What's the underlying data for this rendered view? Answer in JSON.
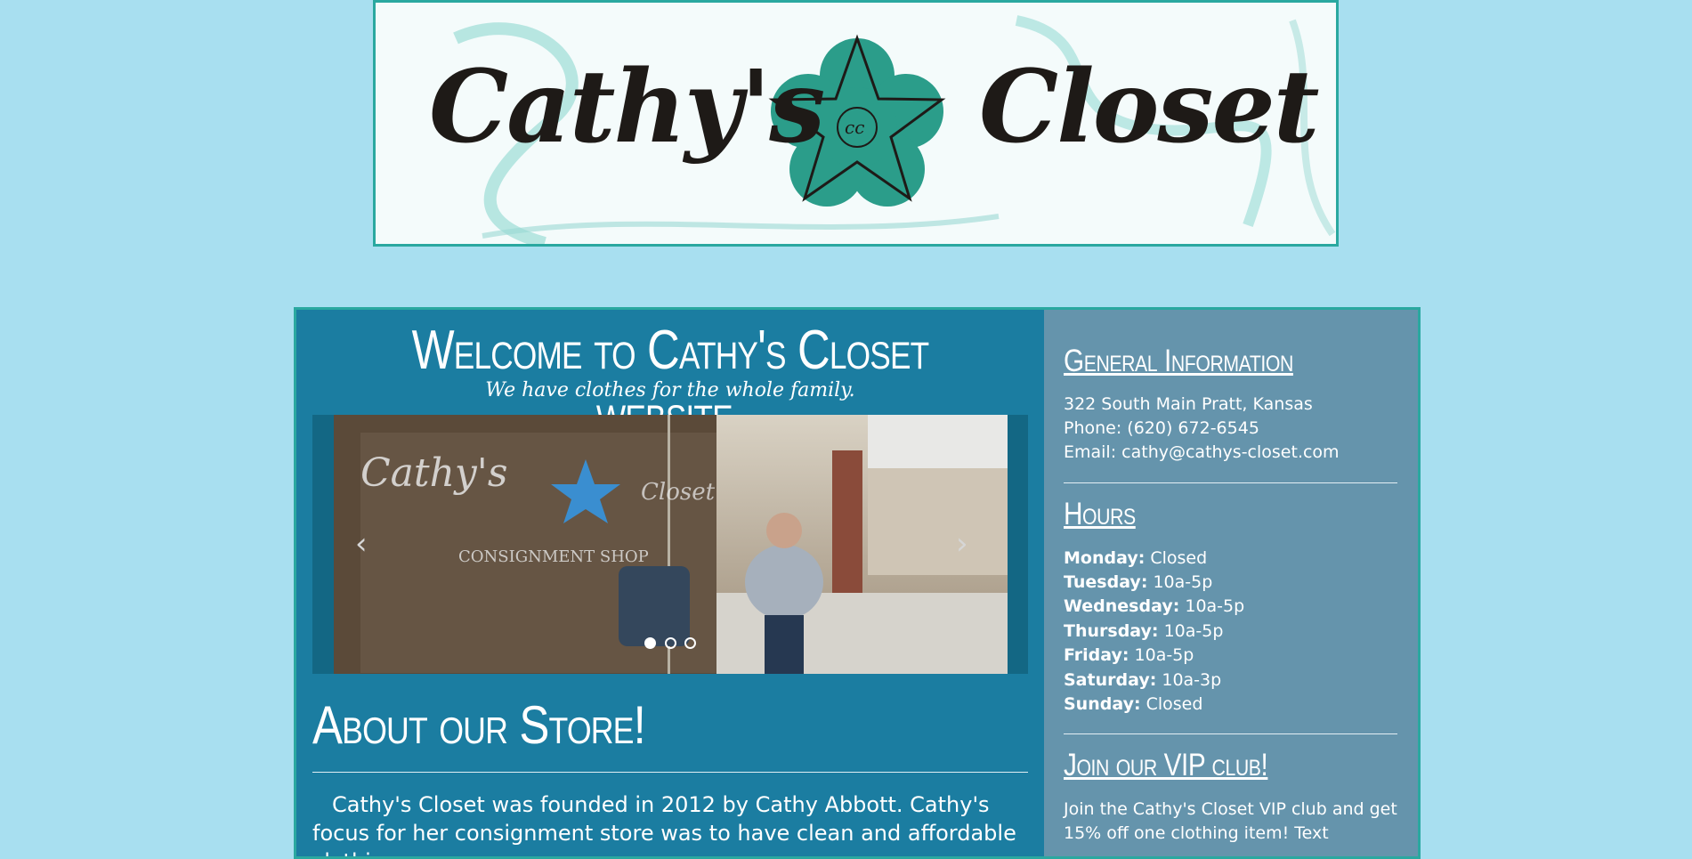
{
  "logo": {
    "left_word": "Cathy's",
    "right_word": "Closet",
    "monogram": "cc"
  },
  "welcome": {
    "title": "Welcome to Cathy's Closet website.",
    "tagline": "We have clothes for the whole family."
  },
  "carousel": {
    "prev_icon": "chevron-left-icon",
    "next_icon": "chevron-right-icon",
    "prev_glyph": "‹",
    "next_glyph": "›",
    "window_sign": "Cathy's",
    "window_sign_2": "Closet",
    "window_sign_3": "CONSIGNMENT SHOP",
    "slides": 3,
    "active_slide": 1
  },
  "about": {
    "heading": "About our Store!",
    "text": "Cathy's Closet was founded in 2012 by Cathy Abbott. Cathy's focus for her consignment store was to have clean and affordable clothing"
  },
  "general": {
    "heading": "General Information",
    "address": "322 South Main Pratt, Kansas",
    "phone": "Phone: (620) 672-6545",
    "email": "Email: cathy@cathys-closet.com"
  },
  "hours": {
    "heading": "Hours",
    "days": [
      {
        "day": "Monday:",
        "time": "Closed"
      },
      {
        "day": "Tuesday:",
        "time": "10a-5p"
      },
      {
        "day": "Wednesday:",
        "time": "10a-5p"
      },
      {
        "day": "Thursday:",
        "time": "10a-5p"
      },
      {
        "day": "Friday:",
        "time": "10a-5p"
      },
      {
        "day": "Saturday:",
        "time": "10a-3p"
      },
      {
        "day": "Sunday:",
        "time": "Closed"
      }
    ]
  },
  "vip": {
    "heading": "Join our VIP club!",
    "line1": "Join the Cathy's Closet VIP club and get",
    "line2": "15% off one clothing item! Text"
  },
  "colors": {
    "page_bg": "#a8dff0",
    "main_bg": "#1b7da1",
    "sidebar_bg": "#6594ac",
    "accent": "#2aa8a0"
  }
}
